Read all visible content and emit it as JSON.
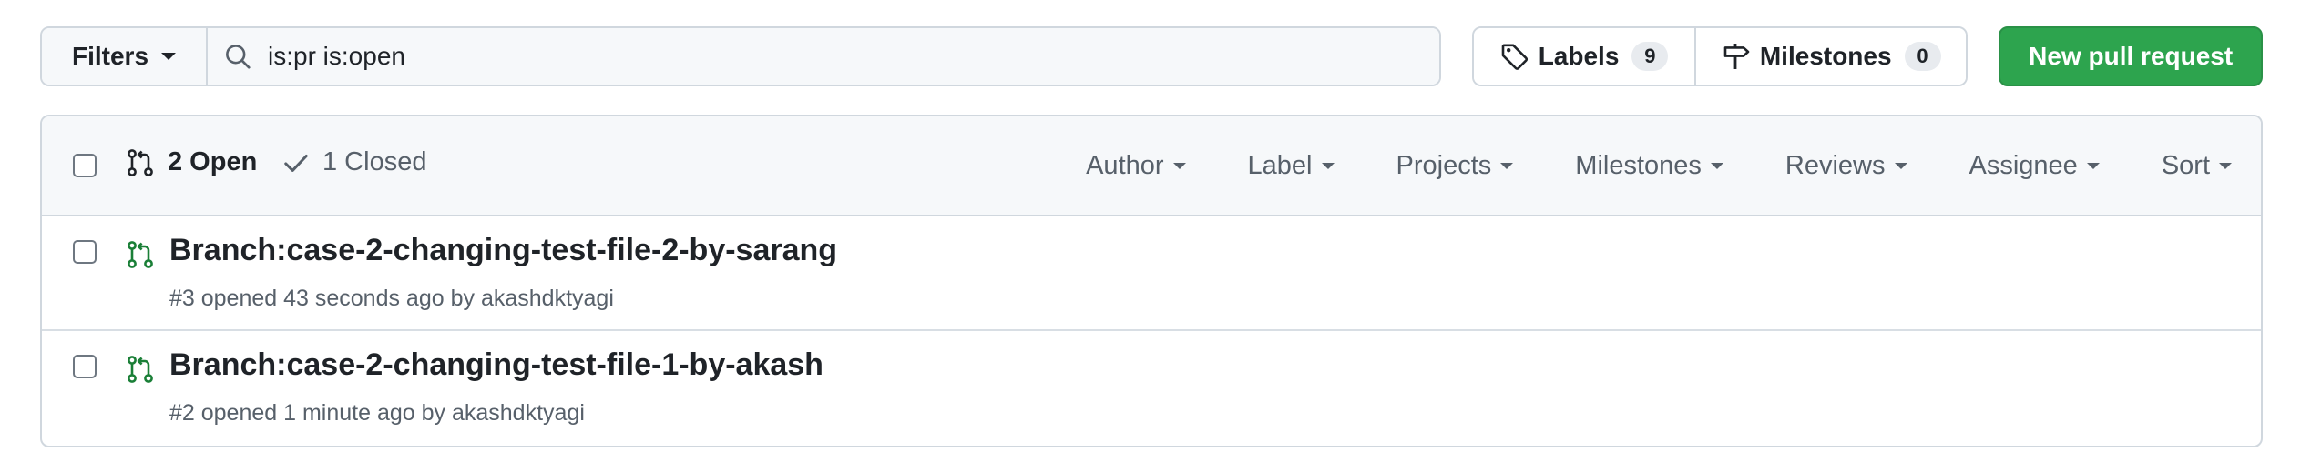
{
  "toolbar": {
    "filters_label": "Filters",
    "search_value": "is:pr is:open",
    "labels_label": "Labels",
    "labels_count": "9",
    "milestones_label": "Milestones",
    "milestones_count": "0",
    "new_pr_label": "New pull request"
  },
  "list_header": {
    "open_label": "2 Open",
    "closed_label": "1 Closed",
    "filters": {
      "author": "Author",
      "label": "Label",
      "projects": "Projects",
      "milestones": "Milestones",
      "reviews": "Reviews",
      "assignee": "Assignee",
      "sort": "Sort"
    }
  },
  "pull_requests": [
    {
      "title": "Branch:case-2-changing-test-file-2-by-sarang",
      "meta_prefix": "#3 opened 43 seconds ago by ",
      "author": "akashdktyagi"
    },
    {
      "title": "Branch:case-2-changing-test-file-1-by-akash",
      "meta_prefix": "#2 opened 1 minute ago by ",
      "author": "akashdktyagi"
    }
  ],
  "colors": {
    "accent_green": "#2da44e",
    "open_pr_icon": "#1a7f37",
    "muted_text": "#57606a",
    "border": "#d0d7de"
  },
  "icons": {
    "search": "search-icon",
    "tag": "tag-icon",
    "milestone": "milestone-icon",
    "pull_request": "git-pull-request-icon",
    "check": "check-icon"
  }
}
